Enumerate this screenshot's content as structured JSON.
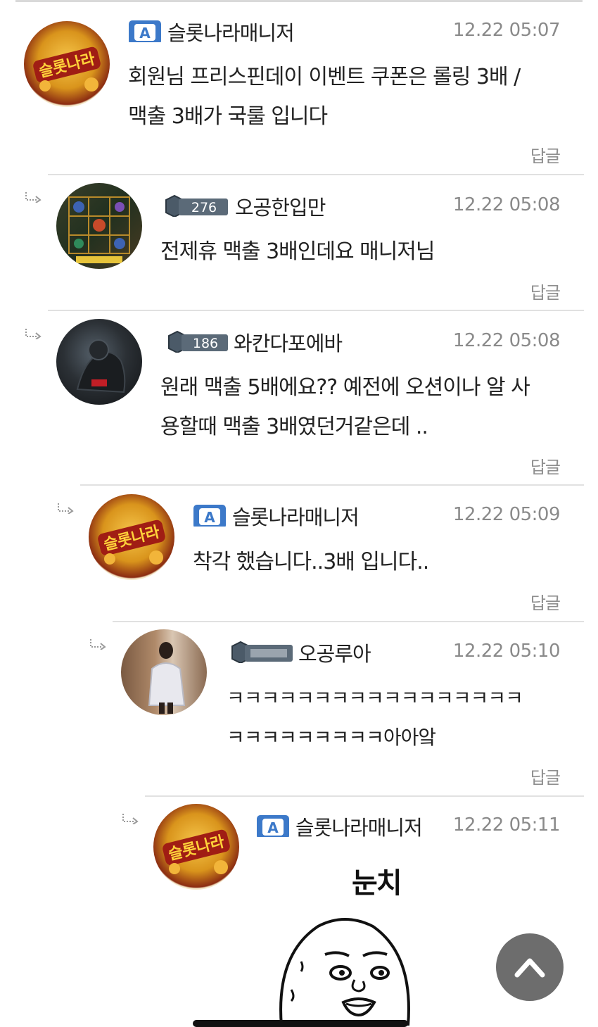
{
  "comments": [
    {
      "nick": "슬롯나라매니저",
      "badge": "admin-icon",
      "time": "12.22 05:07",
      "text": "회원님 프리스핀데이 이벤트 쿠폰은 롤링 3배 /\n맥출 3배가 국룰 입니다",
      "reply": "답글",
      "avatar": "slotnara-logo"
    },
    {
      "nick": "오공한입만",
      "badge": "level-badge",
      "level": "276",
      "time": "12.22 05:08",
      "text": "전제휴 맥출 3배인데요 매니저님",
      "reply": "답글",
      "avatar": "slot-game-avatar"
    },
    {
      "nick": "와칸다포에바",
      "badge": "level-badge",
      "level": "186",
      "time": "12.22 05:08",
      "text": "원래 맥출 5배에요?? 예전에 오션이나 알 사\n용할때 맥출 3배였던거같은데 ..",
      "reply": "답글",
      "avatar": "panther-avatar"
    },
    {
      "nick": "슬롯나라매니저",
      "badge": "admin-icon",
      "time": "12.22 05:09",
      "text": "착각 했습니다..3배 입니다..",
      "reply": "답글",
      "avatar": "slotnara-logo"
    },
    {
      "nick": "오공루아",
      "badge": "level-badge",
      "level": "",
      "time": "12.22 05:10",
      "text": "ㅋㅋㅋㅋㅋㅋㅋㅋㅋㅋㅋㅋㅋㅋㅋㅋㅋ\nㅋㅋㅋㅋㅋㅋㅋㅋㅋ아아앜",
      "reply": "답글",
      "avatar": "woman-photo-avatar"
    },
    {
      "nick": "슬롯나라매니저",
      "badge": "admin-icon",
      "time": "12.22 05:11",
      "text": "",
      "reply": "",
      "avatar": "slotnara-logo",
      "sticker_text": "눈치"
    }
  ],
  "scroll_top_icon": "chevron-up-icon",
  "colors": {
    "divider": "#e1e1e1",
    "time": "#8a8a8a",
    "scroll_button": "#6d6d6d",
    "admin_badge": "#3c79c9"
  }
}
